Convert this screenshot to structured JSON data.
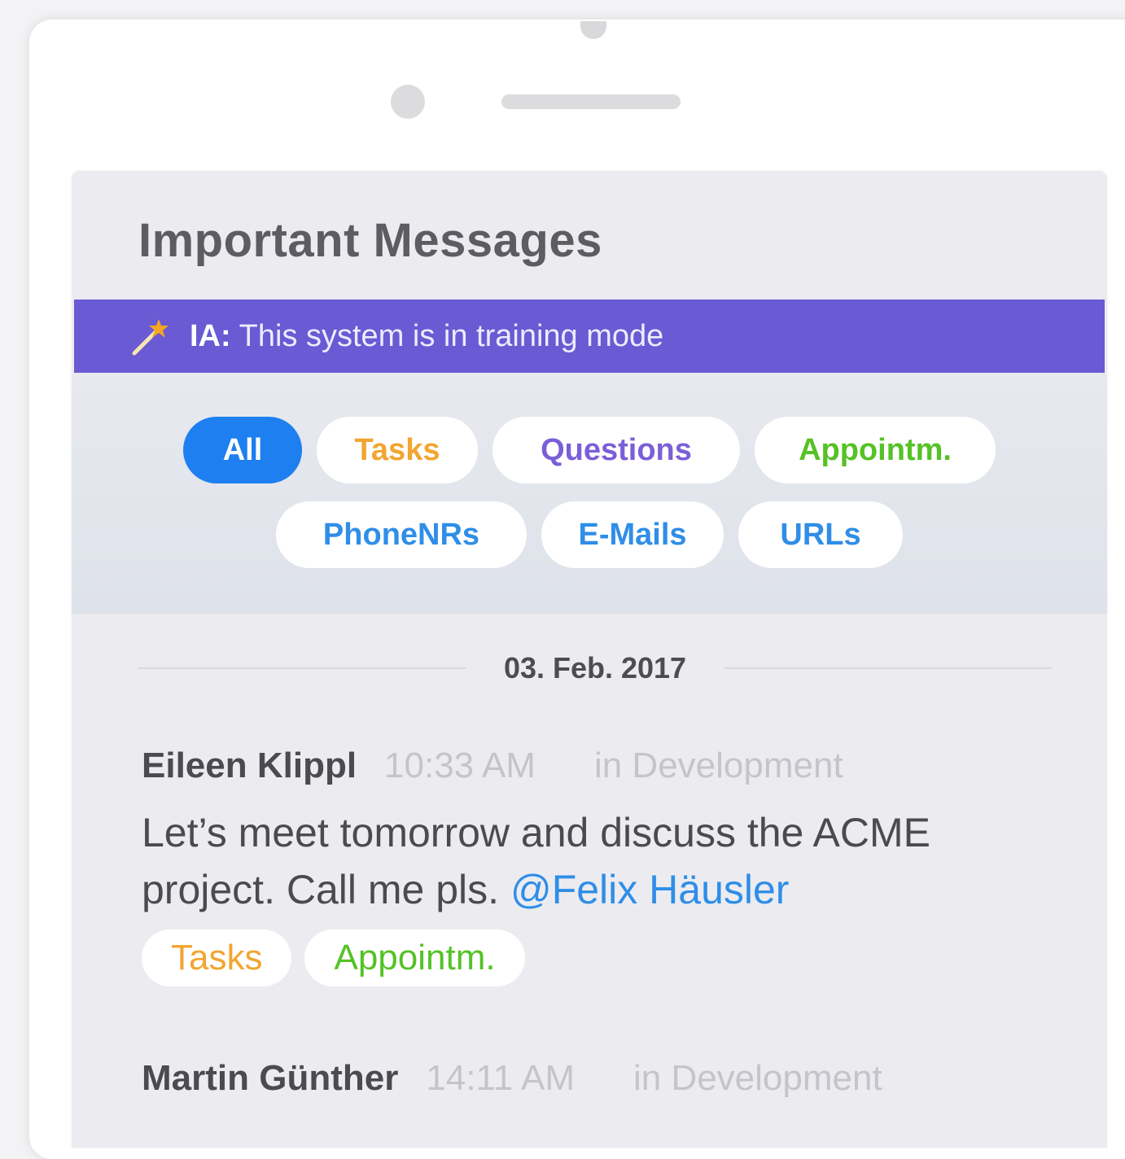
{
  "panel": {
    "title": "Important Messages"
  },
  "banner": {
    "label": "IA:",
    "text": "This system is in training mode",
    "icon": "magic-wand-icon",
    "background": "#6a5ad3"
  },
  "filters": {
    "row1": [
      {
        "label": "All",
        "color": "#ffffff",
        "active": true
      },
      {
        "label": "Tasks",
        "color": "#f2a531"
      },
      {
        "label": "Questions",
        "color": "#7a5fd8"
      },
      {
        "label": "Appointm.",
        "color": "#55c225"
      }
    ],
    "row2": [
      {
        "label": "PhoneNRs",
        "color": "#2f8ee8"
      },
      {
        "label": "E-Mails",
        "color": "#2f8ee8"
      },
      {
        "label": "URLs",
        "color": "#2f8ee8"
      }
    ],
    "active_color": "#1e7ff0"
  },
  "date_separator": "03. Feb. 2017",
  "messages": [
    {
      "sender": "Eileen Klippl",
      "time": "10:33 AM",
      "channel": "in Development",
      "text": "Let’s meet tomorrow and discuss the ACME project. Call me pls. ",
      "mention": "@Felix Häusler",
      "tags": [
        {
          "label": "Tasks",
          "color": "#f2a531"
        },
        {
          "label": "Appointm.",
          "color": "#55c225"
        }
      ]
    },
    {
      "sender": "Martin Günther",
      "time": "14:11 AM",
      "channel": "in Development"
    }
  ]
}
